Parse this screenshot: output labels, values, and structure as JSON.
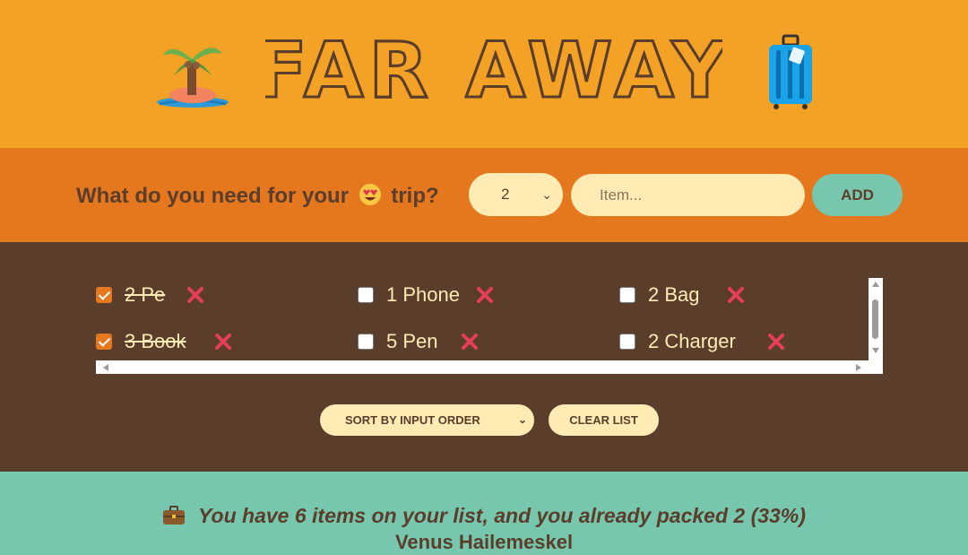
{
  "header": {
    "title": "FAR AWAY",
    "left_icon": "palm-island-icon",
    "right_icon": "suitcase-icon"
  },
  "form": {
    "question_before": "What do you need for your",
    "question_after": "trip?",
    "emoji": "heart-eyes-emoji-icon",
    "quantity": "2",
    "item_placeholder": "Item...",
    "add_label": "ADD"
  },
  "list": {
    "items": [
      {
        "label": "2 Pe",
        "packed": true
      },
      {
        "label": "1 Phone",
        "packed": false
      },
      {
        "label": "2 Bag",
        "packed": false
      },
      {
        "label": "3 Book",
        "packed": true
      },
      {
        "label": "5 Pen",
        "packed": false
      },
      {
        "label": "2 Charger",
        "packed": false
      }
    ]
  },
  "actions": {
    "sort_label": "SORT BY INPUT ORDER",
    "clear_label": "CLEAR LIST"
  },
  "footer": {
    "stats": "You have 6 items on your list, and you already packed 2 (33%)",
    "author": "Venus Hailemeskel"
  },
  "colors": {
    "header_bg": "#f4a226",
    "form_bg": "#e5771f",
    "list_bg": "#5a3e2b",
    "footer_bg": "#76c7ad",
    "cream": "#ffebb3",
    "delete_red": "#e63d5a"
  }
}
